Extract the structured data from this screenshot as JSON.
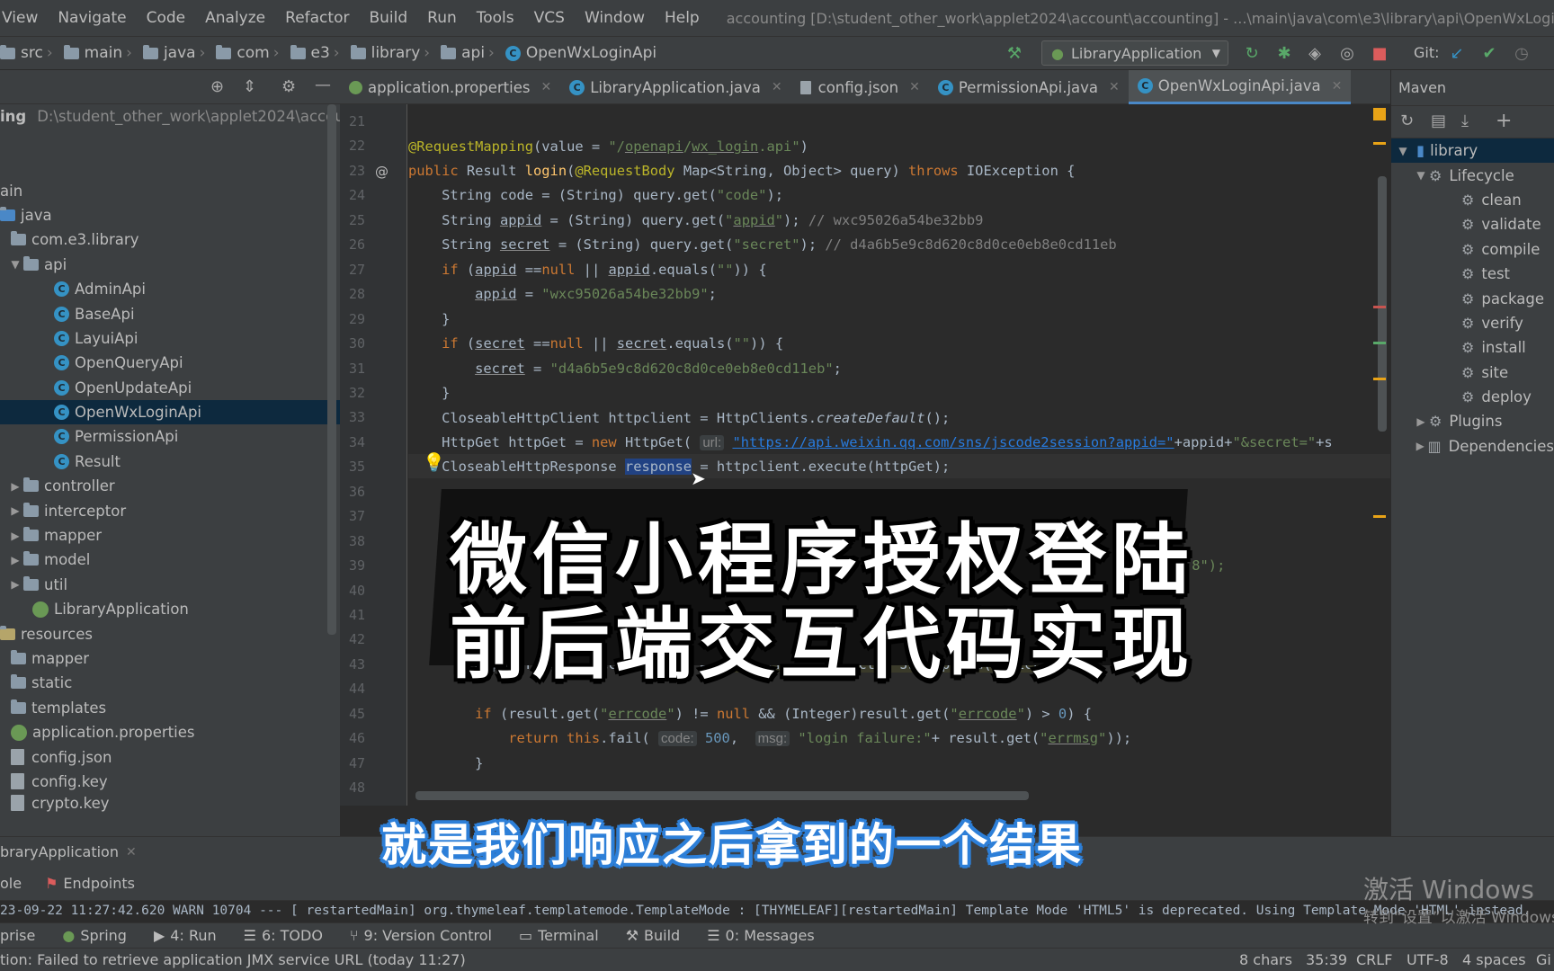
{
  "menu": {
    "items": [
      "View",
      "Navigate",
      "Code",
      "Analyze",
      "Refactor",
      "Build",
      "Run",
      "Tools",
      "VCS",
      "Window",
      "Help"
    ],
    "window_title": "accounting [D:\\student_other_work\\applet2024\\account\\accounting] - ...\\main\\java\\com\\e3\\library\\api\\OpenWxLoginApi.java"
  },
  "breadcrumb": [
    "src",
    "main",
    "java",
    "com",
    "e3",
    "library",
    "api",
    "OpenWxLoginApi"
  ],
  "toolbar": {
    "run_config": "LibraryApplication",
    "git_label": "Git:"
  },
  "project": {
    "root_label": "ing",
    "root_path": "D:\\student_other_work\\applet2024\\account\\",
    "items": [
      {
        "label": "ain",
        "type": "plain"
      },
      {
        "label": "java",
        "type": "folder"
      },
      {
        "label": "com.e3.library",
        "type": "folder"
      },
      {
        "label": "api",
        "type": "folder"
      },
      {
        "label": "AdminApi",
        "type": "class"
      },
      {
        "label": "BaseApi",
        "type": "class"
      },
      {
        "label": "LayuiApi",
        "type": "class"
      },
      {
        "label": "OpenQueryApi",
        "type": "class"
      },
      {
        "label": "OpenUpdateApi",
        "type": "class"
      },
      {
        "label": "OpenWxLoginApi",
        "type": "class"
      },
      {
        "label": "PermissionApi",
        "type": "class"
      },
      {
        "label": "Result",
        "type": "class"
      },
      {
        "label": "controller",
        "type": "folder"
      },
      {
        "label": "interceptor",
        "type": "folder"
      },
      {
        "label": "mapper",
        "type": "folder"
      },
      {
        "label": "model",
        "type": "folder"
      },
      {
        "label": "util",
        "type": "folder"
      },
      {
        "label": "LibraryApplication",
        "type": "spring"
      },
      {
        "label": "resources",
        "type": "folder"
      },
      {
        "label": "mapper",
        "type": "folder"
      },
      {
        "label": "static",
        "type": "folder"
      },
      {
        "label": "templates",
        "type": "folder"
      },
      {
        "label": "application.properties",
        "type": "spring"
      },
      {
        "label": "config.json",
        "type": "file"
      },
      {
        "label": "config.key",
        "type": "file"
      },
      {
        "label": "crypto.key",
        "type": "file"
      }
    ]
  },
  "tabs": [
    {
      "label": "application.properties"
    },
    {
      "label": "LibraryApplication.java"
    },
    {
      "label": "config.json"
    },
    {
      "label": "PermissionApi.java"
    },
    {
      "label": "OpenWxLoginApi.java",
      "active": true
    }
  ],
  "line_numbers": [
    "21",
    "22",
    "23",
    "24",
    "25",
    "26",
    "27",
    "28",
    "29",
    "30",
    "31",
    "32",
    "33",
    "34",
    "35",
    "36",
    "37",
    "38",
    "39",
    "40",
    "41",
    "42",
    "43",
    "44",
    "45",
    "46",
    "47",
    "48"
  ],
  "code": {
    "l22": [
      "@RequestMapping(value = \"/",
      "openapi",
      "/",
      "wx_login.api",
      "\")"
    ],
    "l25_comment": "// wxc95026a54be32bb9",
    "l26_comment": "// d4a6b5e9c8d620c8d0ce0eb8e0cd11eb",
    "l28_value": "\"wxc95026a54be32bb9\"",
    "l31_value": "\"d4a6b5e9c8d620c8d0ce0eb8e0cd11eb\"",
    "l34_hint": "url:",
    "l34_url": "\"https://api.weixin.qq.com/sns/jscode2session?appid=\"",
    "l39_tail": "-8\");",
    "l46_hint_code": "code:",
    "l46_hint_msg": "msg:",
    "l46_str": "\"login failure:\""
  },
  "maven": {
    "title": "Maven",
    "project": "library",
    "lifecycle": "Lifecycle",
    "goals": [
      "clean",
      "validate",
      "compile",
      "test",
      "package",
      "verify",
      "install",
      "site",
      "deploy"
    ],
    "plugins": "Plugins",
    "dependencies": "Dependencies"
  },
  "run": {
    "config_tab": "braryApplication",
    "tabs": [
      "ole",
      "Endpoints"
    ],
    "console_line": "23-09-22 11:27:42.620  WARN 10704 --- [  restartedMain] org.thymeleaf.templatemode.TemplateMode  : [THYMELEAF][restartedMain] Template Mode 'HTML5' is deprecated. Using Template Mode 'HTML' instead."
  },
  "tool_windows": [
    "prise",
    "Spring",
    "4: Run",
    "6: TODO",
    "9: Version Control",
    "Terminal",
    "Build",
    "0: Messages"
  ],
  "status": {
    "message": "tion: Failed to retrieve application JMX service URL (today 11:27)",
    "chars": "8 chars",
    "position": "35:39",
    "line_sep": "CRLF",
    "encoding": "UTF-8",
    "indent": "4 spaces",
    "git": "Gi"
  },
  "overlay": {
    "title_line1": "微信小程序授权登陆",
    "title_line2": "前后端交互代码实现",
    "subtitle": "就是我们响应之后拿到的一个结果",
    "watermark": "激活 Windows",
    "watermark_sub": "转到“设置”以激活 Windows。"
  }
}
